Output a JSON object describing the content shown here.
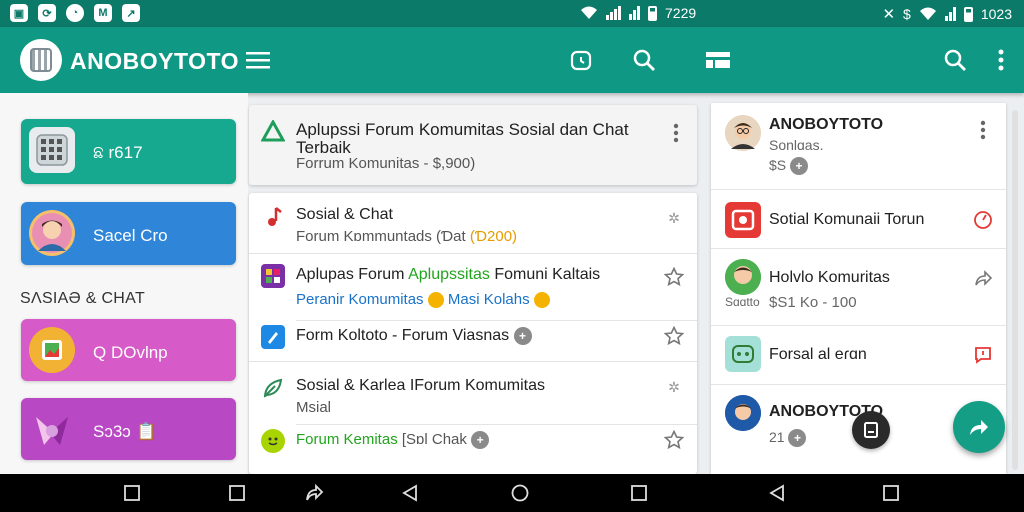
{
  "status_bar": {
    "left_icons": [
      "photo-icon",
      "sync-icon",
      "messenger-icon",
      "gmail-icon",
      "chart-icon"
    ],
    "time_left": "7229",
    "time_right": "1023"
  },
  "app_bar": {
    "title": "ANOBOYTOTO"
  },
  "left_tiles": [
    {
      "label": "ଛ r617",
      "color": "#16a98f"
    },
    {
      "label": "Sacel Cro",
      "color": "#2f86d8"
    },
    {
      "label": "Q  DOvlnp",
      "color": "#d65ac7"
    },
    {
      "label": "Sɔ3ɔ 📋",
      "color": "#b848c4"
    }
  ],
  "section_label": "SɅSIAƏ & CHAT",
  "top_card": {
    "title_line1": "Aplupssi Forum Komumitas  Sosial dan Chat",
    "title_line2": "Terbaik",
    "subtitle": "Forrum Komunitas  - $,900)"
  },
  "feed": [
    {
      "title": "Sosial & Chat",
      "sub_text": "Forum Kɒmmuntads (Ɗat",
      "sub_highlight": "(Ɗ200)"
    },
    {
      "title_text": "Aplupas Forum ",
      "title_highlight": "Aplupssitas",
      "title_tail": " Fomuni Kaltais",
      "sub_text": "Peranir Komumitas ",
      "sub_tail": " Masi Kolahs"
    },
    {
      "title": "Form Koltoto - Forum Viasnas",
      "badge": "+"
    },
    {
      "title": "Sosial & Karlea  IForum Komumitas",
      "sub_text": "Msial"
    },
    {
      "title": "Forum Kemitas",
      "sub_text": " [Sɒl Chak",
      "badge": "+"
    }
  ],
  "right_list": [
    {
      "name": "ANOBOYTOTO",
      "sub": "Sonlɑas.",
      "meta": "$S",
      "badge": "+"
    },
    {
      "name": "Sotial Komunaii Torun"
    },
    {
      "name": "Holvlo Komuritas",
      "prefix": "Sɑɑtto",
      "sub": "$S1 Ko  - 100"
    },
    {
      "name": "Forsal al eɾɑn"
    },
    {
      "name": "ANOBOYTOTO",
      "sub": "21",
      "badge": "+"
    }
  ],
  "colors": {
    "primary": "#0f9883",
    "status": "#0c7a69",
    "accent_orange": "#e59c00",
    "accent_green": "#22a41e",
    "accent_blue": "#1a73c8"
  }
}
